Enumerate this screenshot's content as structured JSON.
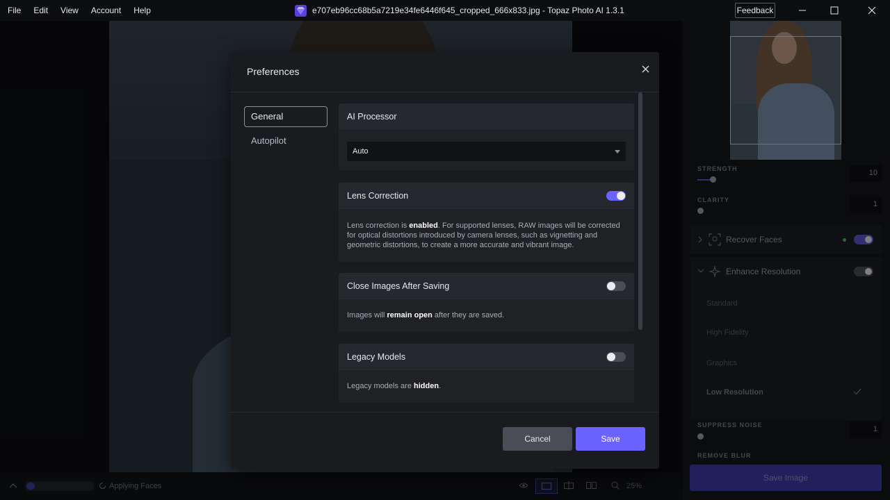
{
  "menu": [
    "File",
    "Edit",
    "View",
    "Account",
    "Help"
  ],
  "window": {
    "title": "e707eb96cc68b5a7219e34fe6446f645_cropped_666x833.jpg - Topaz Photo AI 1.3.1",
    "feedback_label": "Feedback"
  },
  "right_panel": {
    "strength_label": "STRENGTH",
    "strength_value": "10",
    "clarity_label": "CLARITY",
    "clarity_value": "1",
    "recover_faces_label": "Recover Faces",
    "enhance_resolution_label": "Enhance Resolution",
    "options": [
      "Standard",
      "High Fidelity",
      "Graphics",
      "Low Resolution"
    ],
    "suppress_noise_label": "SUPPRESS NOISE",
    "suppress_noise_value": "1",
    "remove_blur_label": "REMOVE BLUR",
    "save_image_label": "Save Image"
  },
  "bottom_bar": {
    "status_text": "Applying Faces",
    "zoom": "25%"
  },
  "modal": {
    "title": "Preferences",
    "nav": {
      "general": "General",
      "autopilot": "Autopilot"
    },
    "ai_processor": {
      "label": "AI Processor",
      "selected": "Auto"
    },
    "lens_correction": {
      "label": "Lens Correction",
      "enabled": true,
      "desc_pre": "Lens correction is ",
      "desc_bold": "enabled",
      "desc_post": ". For supported lenses, RAW images will be corrected for optical distortions introduced by camera lenses, such as vignetting and geometric distortions, to create a more accurate and vibrant image."
    },
    "close_images": {
      "label": "Close Images After Saving",
      "enabled": false,
      "desc_pre": "Images will ",
      "desc_bold": "remain open",
      "desc_post": " after they are saved."
    },
    "legacy_models": {
      "label": "Legacy Models",
      "enabled": false,
      "desc_pre": "Legacy models are ",
      "desc_bold": "hidden",
      "desc_post": "."
    },
    "cancel_label": "Cancel",
    "save_label": "Save"
  },
  "colors": {
    "accent": "#6b63ff",
    "background": "#191b1f"
  }
}
